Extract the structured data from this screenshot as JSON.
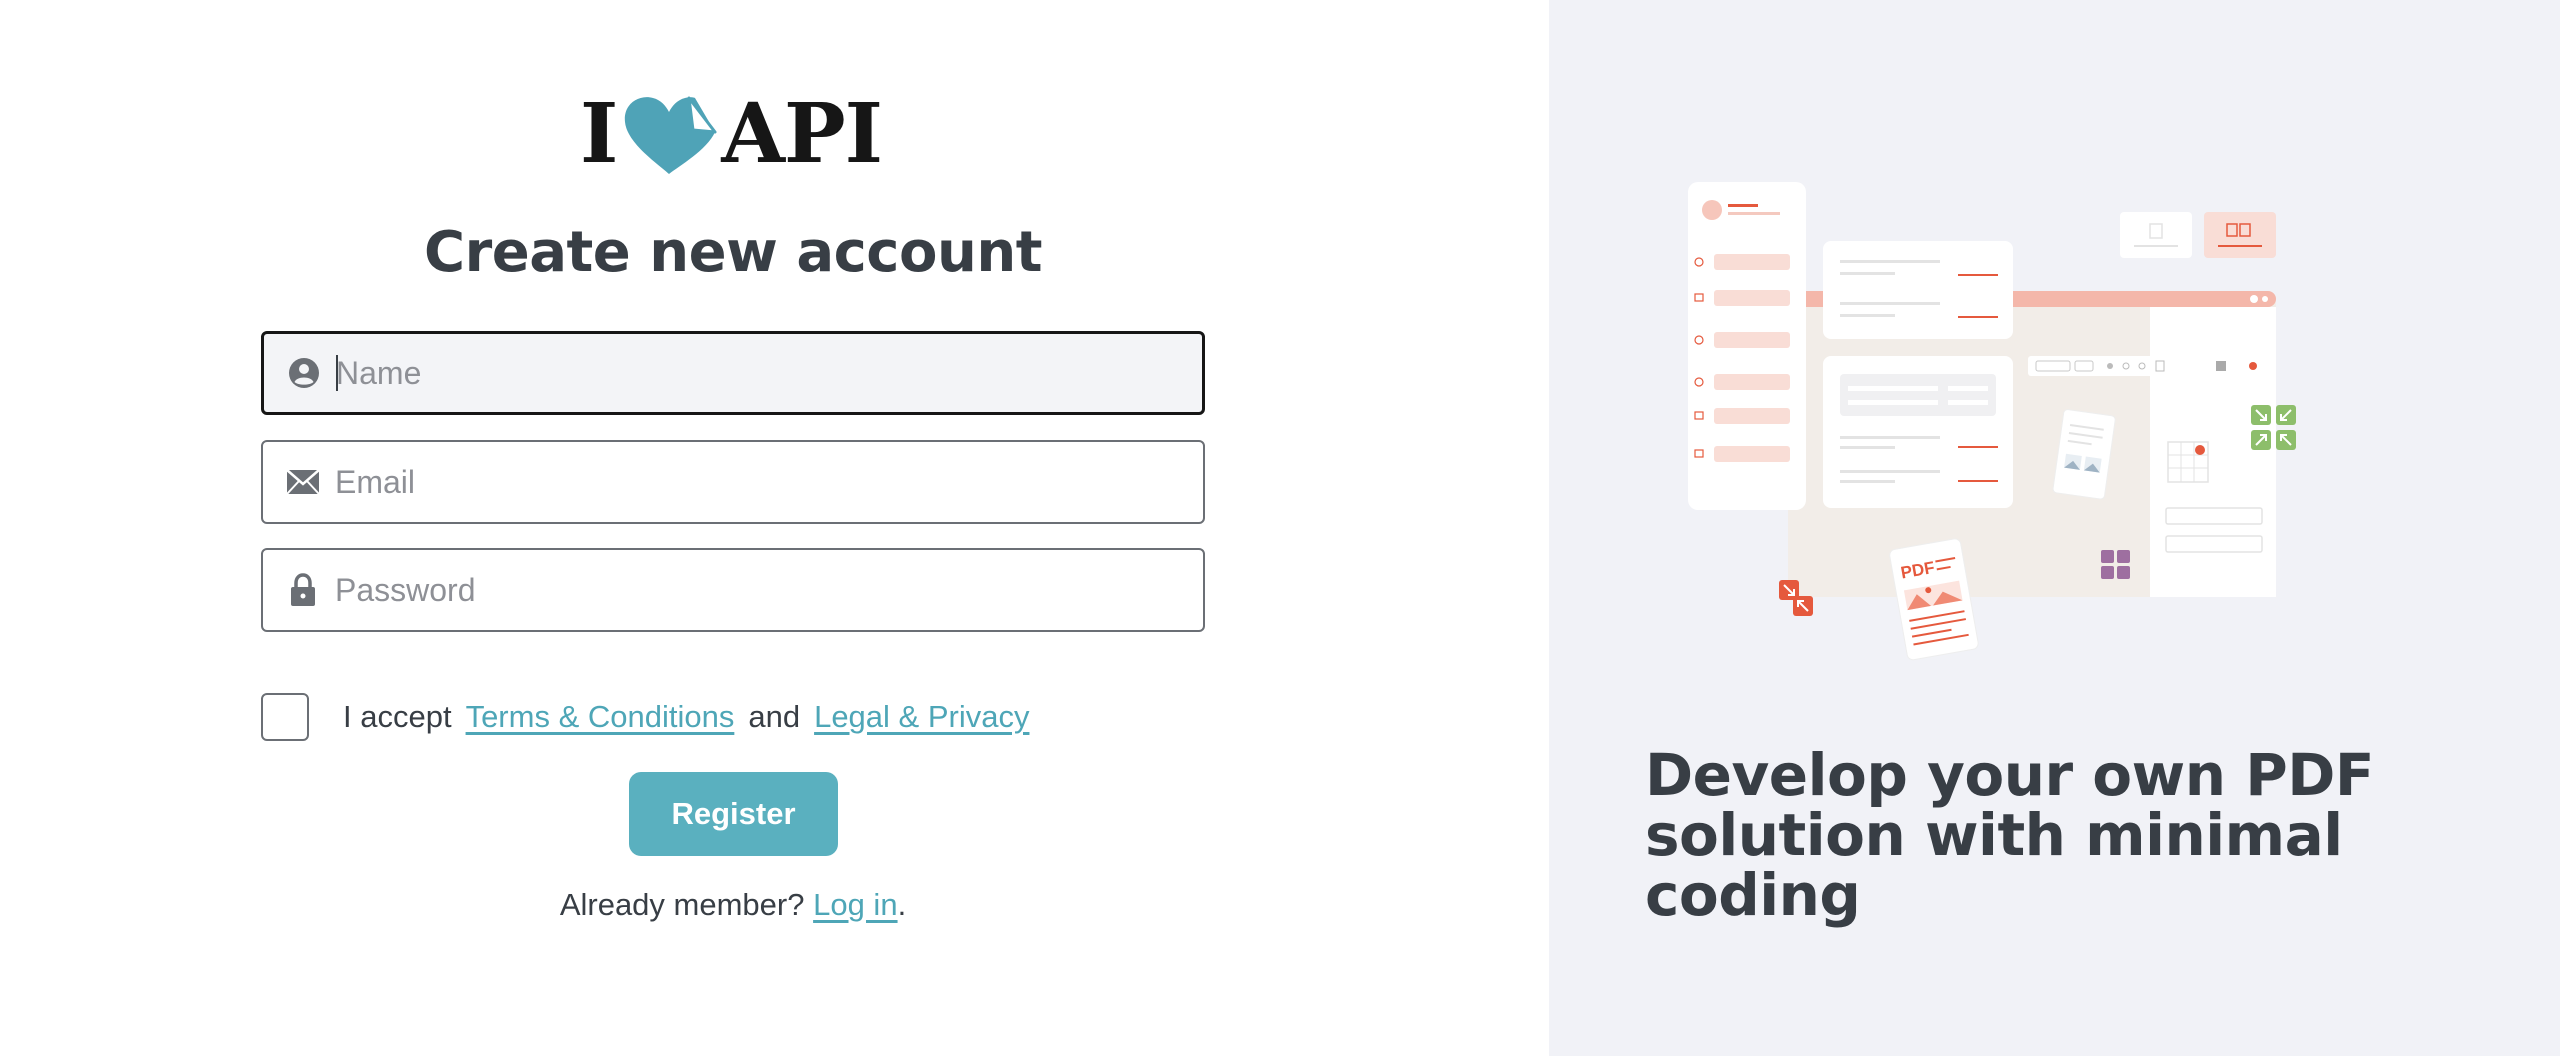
{
  "logo": {
    "text_left": "I",
    "text_right": "API"
  },
  "form": {
    "title": "Create new account",
    "name_placeholder": "Name",
    "email_placeholder": "Email",
    "password_placeholder": "Password",
    "terms_prefix": "I accept",
    "terms_link": "Terms & Conditions",
    "terms_and": "and",
    "privacy_link": "Legal & Privacy",
    "register_label": "Register",
    "login_prefix": "Already member?",
    "login_link": "Log in",
    "login_suffix": "."
  },
  "promo": {
    "tagline": "Develop your own PDF solution with minimal coding",
    "illustration_label": "PDF"
  },
  "colors": {
    "accent": "#5AB0BF",
    "link": "#4EA6B7",
    "text": "#383E45",
    "panel": "#F1F2F7",
    "illustration_red": "#E5593D"
  }
}
